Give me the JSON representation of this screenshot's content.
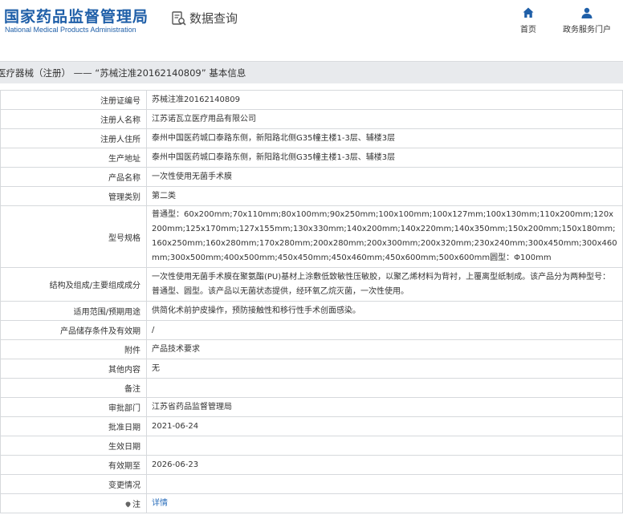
{
  "header": {
    "logo_cn": "国家药品监督管理局",
    "logo_en": "National Medical Products Administration",
    "query_label": "数据查询",
    "query_icon": "search-document-icon",
    "nav": [
      {
        "label": "首页",
        "icon": "home-icon"
      },
      {
        "label": "政务服务门户",
        "icon": "user-icon"
      }
    ],
    "accent_color": "#1f5fa8"
  },
  "title_bar": {
    "text": "医疗器械（注册） —— “苏械注准20162140809” 基本信息"
  },
  "rows": [
    {
      "label": "注册证编号",
      "value": "苏械注准20162140809"
    },
    {
      "label": "注册人名称",
      "value": "江苏诺瓦立医疗用品有限公司"
    },
    {
      "label": "注册人住所",
      "value": "泰州中国医药城口泰路东侧，新阳路北侧G35幢主楼1-3层、辅楼3层"
    },
    {
      "label": "生产地址",
      "value": "泰州中国医药城口泰路东侧，新阳路北侧G35幢主楼1-3层、辅楼3层"
    },
    {
      "label": "产品名称",
      "value": "一次性使用无菌手术膜"
    },
    {
      "label": "管理类别",
      "value": "第二类"
    },
    {
      "label": "型号规格",
      "value": "普通型：60x200mm;70x110mm;80x100mm;90x250mm;100x100mm;100x127mm;100x130mm;110x200mm;120x200mm;125x170mm;127x155mm;130x330mm;140x200mm;140x220mm;140x350mm;150x200mm;150x180mm;160x250mm;160x280mm;170x280mm;200x280mm;200x300mm;200x320mm;230x240mm;300x450mm;300x460mm;300x500mm;400x500mm;450x450mm;450x460mm;450x600mm;500x600mm圆型：Φ100mm"
    },
    {
      "label": "结构及组成/主要组成成分",
      "value": "一次性使用无菌手术膜在聚氨酯(PU)基材上涂敷低致敏性压敏胶，以聚乙烯材料为背衬，上覆离型纸制成。该产品分为两种型号：普通型、圆型。该产品以无菌状态提供，经环氧乙烷灭菌，一次性使用。"
    },
    {
      "label": "适用范围/预期用途",
      "value": "供简化术前护皮操作，预防接触性和移行性手术创面感染。"
    },
    {
      "label": "产品储存条件及有效期",
      "value": "/"
    },
    {
      "label": "附件",
      "value": "产品技术要求"
    },
    {
      "label": "其他内容",
      "value": "无"
    },
    {
      "label": "备注",
      "value": ""
    },
    {
      "label": "审批部门",
      "value": "江苏省药品监督管理局"
    },
    {
      "label": "批准日期",
      "value": "2021-06-24"
    },
    {
      "label": "生效日期",
      "value": ""
    },
    {
      "label": "有效期至",
      "value": "2026-06-23"
    },
    {
      "label": "变更情况",
      "value": ""
    },
    {
      "label": "注",
      "value": "详情",
      "icon": "note-icon"
    }
  ]
}
